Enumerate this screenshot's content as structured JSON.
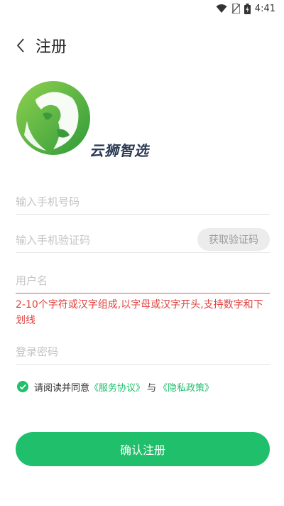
{
  "status_bar": {
    "time": "4:41"
  },
  "header": {
    "title": "注册"
  },
  "brand": {
    "name": "云狮智选",
    "color": "#2b3a55",
    "logo_color": "#6bbf3f"
  },
  "form": {
    "phone_placeholder": "输入手机号码",
    "code_placeholder": "输入手机验证码",
    "code_button": "获取验证码",
    "username_placeholder": "用户名",
    "username_hint": "2-10个字符或汉字组成,以字母或汉字开头,支持数字和下划线",
    "password_placeholder": "登录密码"
  },
  "agreement": {
    "prefix": "请阅读并同意",
    "service_link": "《服务协议》",
    "joiner": "与",
    "privacy_link": "《隐私政策》",
    "checked": true
  },
  "submit": {
    "label": "确认注册"
  },
  "colors": {
    "accent": "#1fbf6b",
    "error": "#e0433f",
    "placeholder": "#c4c4c4"
  }
}
